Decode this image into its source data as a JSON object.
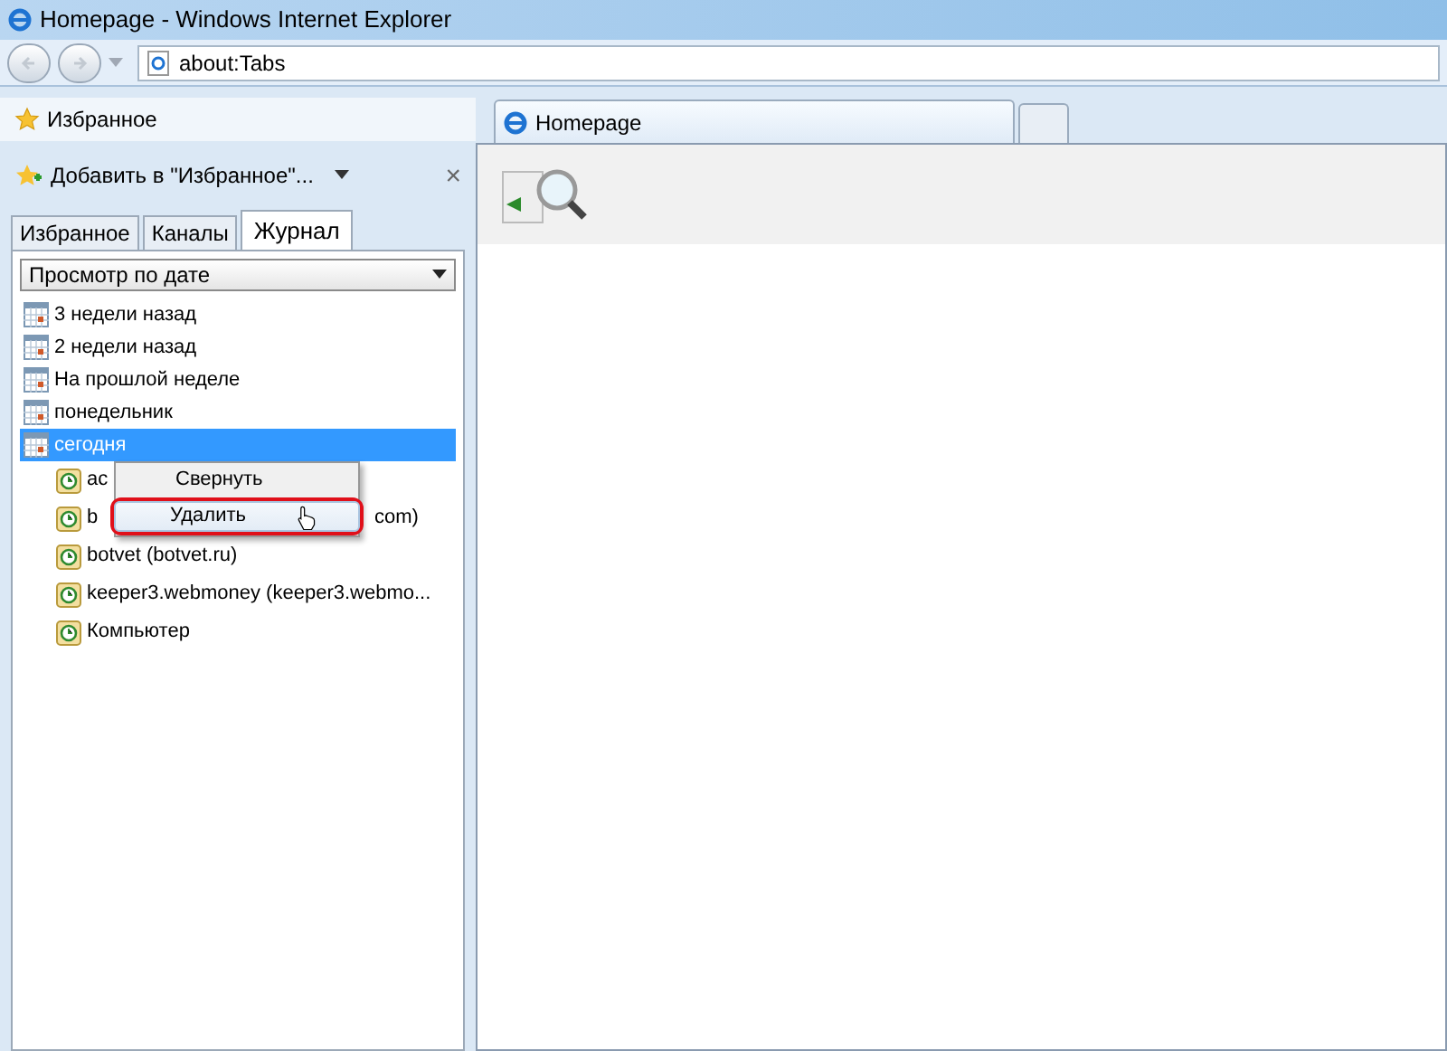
{
  "window": {
    "title": "Homepage - Windows Internet Explorer"
  },
  "address_bar": {
    "value": "about:Tabs"
  },
  "favorites_panel": {
    "title": "Избранное",
    "add_button": "Добавить в \"Избранное\"...",
    "close": "×",
    "tabs": [
      {
        "label": "Избранное",
        "selected": false
      },
      {
        "label": "Каналы",
        "selected": false
      },
      {
        "label": "Журнал",
        "selected": true
      }
    ],
    "view_dropdown": "Просмотр по дате",
    "history": [
      {
        "label": "3 недели назад",
        "kind": "period",
        "selected": false
      },
      {
        "label": "2 недели назад",
        "kind": "period",
        "selected": false
      },
      {
        "label": "На прошлой неделе",
        "kind": "period",
        "selected": false
      },
      {
        "label": "понедельник",
        "kind": "period",
        "selected": false
      },
      {
        "label": "сегодня",
        "kind": "period",
        "selected": true,
        "children": [
          {
            "label": "ac",
            "kind": "site",
            "selected": false
          },
          {
            "label": "b",
            "tail": "com)",
            "kind": "site",
            "selected": false
          },
          {
            "label": "botvet (botvet.ru)",
            "kind": "site",
            "selected": false
          },
          {
            "label": "keeper3.webmoney (keeper3.webmo...",
            "kind": "site",
            "selected": false
          },
          {
            "label": "Компьютер",
            "kind": "site",
            "selected": false
          }
        ]
      }
    ]
  },
  "context_menu": {
    "items": [
      {
        "label": "Свернуть",
        "selected": false,
        "highlighted_ring": false
      },
      {
        "label": "Удалить",
        "selected": true,
        "highlighted_ring": true
      }
    ]
  },
  "browser_tabs": [
    {
      "label": "Homepage",
      "selected": true
    },
    {
      "selected": false
    }
  ]
}
